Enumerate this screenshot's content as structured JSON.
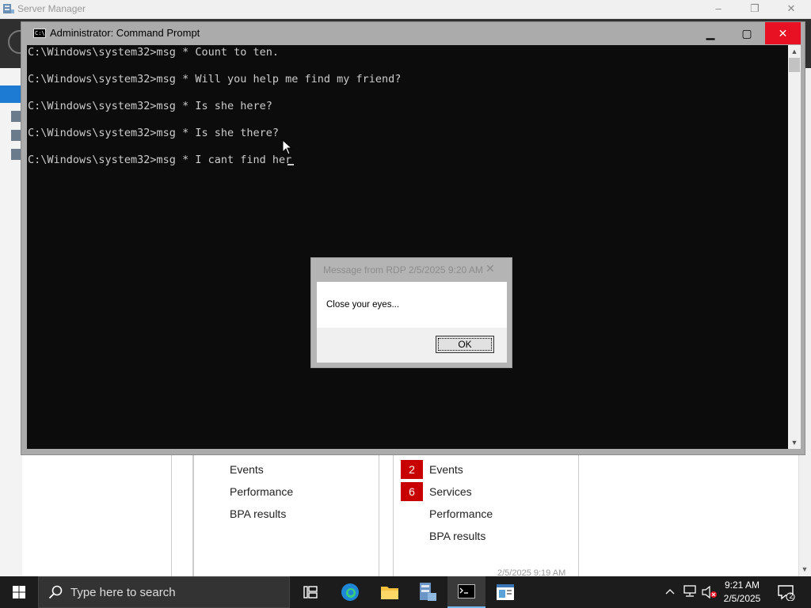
{
  "server_manager": {
    "title": "Server Manager",
    "minimize": "–",
    "restore": "❐",
    "close": "✕",
    "tile_left": {
      "items": [
        "Events",
        "Performance",
        "BPA results"
      ]
    },
    "tile_right": {
      "items": [
        {
          "badge": "2",
          "label": "Events"
        },
        {
          "badge": "6",
          "label": "Services"
        },
        {
          "badge": "",
          "label": "Performance"
        },
        {
          "badge": "",
          "label": "BPA results"
        }
      ]
    },
    "timestamp": "2/5/2025 9:19 AM"
  },
  "cmd": {
    "title": "Administrator: Command Prompt",
    "icon_text": "C:\\",
    "minimize": "▁",
    "maximize": "▢",
    "close": "✕",
    "lines": [
      "C:\\Windows\\system32>msg * Count to ten.",
      "C:\\Windows\\system32>msg * Will you help me find my friend?",
      "C:\\Windows\\system32>msg * Is she here?",
      "C:\\Windows\\system32>msg * Is she there?",
      "C:\\Windows\\system32>msg * I cant find her"
    ]
  },
  "dialog": {
    "title": "Message from RDP 2/5/2025 9:20 AM",
    "close": "✕",
    "message": "Close your eyes...",
    "ok_label": "OK"
  },
  "taskbar": {
    "search_placeholder": "Type here to search",
    "time": "9:21 AM",
    "date": "2/5/2025",
    "notification_count": "2",
    "accent": "#76b9ed"
  }
}
